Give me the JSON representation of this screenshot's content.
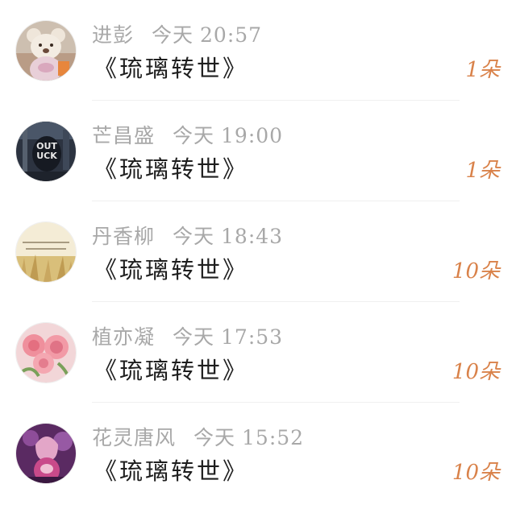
{
  "messages": [
    {
      "name": "进彭",
      "day": "今天",
      "time": "20:57",
      "text": "《琉璃转世》",
      "count": "1朵",
      "avatar_icon": "teddy-bear-photo"
    },
    {
      "name": "芒昌盛",
      "day": "今天",
      "time": "19:00",
      "text": "《琉璃转世》",
      "count": "1朵",
      "avatar_icon": "dark-poster-photo"
    },
    {
      "name": "丹香柳",
      "day": "今天",
      "time": "18:43",
      "text": "《琉璃转世》",
      "count": "10朵",
      "avatar_icon": "wheat-field-photo"
    },
    {
      "name": "植亦凝",
      "day": "今天",
      "time": "17:53",
      "text": "《琉璃转世》",
      "count": "10朵",
      "avatar_icon": "pink-roses-photo"
    },
    {
      "name": "花灵唐风",
      "day": "今天",
      "time": "15:52",
      "text": "《琉璃转世》",
      "count": "10朵",
      "avatar_icon": "anime-girl-photo"
    }
  ],
  "colors": {
    "meta": "#a8a8a8",
    "text": "#1e1e1e",
    "count": "#d9824a",
    "background": "#ffffff"
  }
}
